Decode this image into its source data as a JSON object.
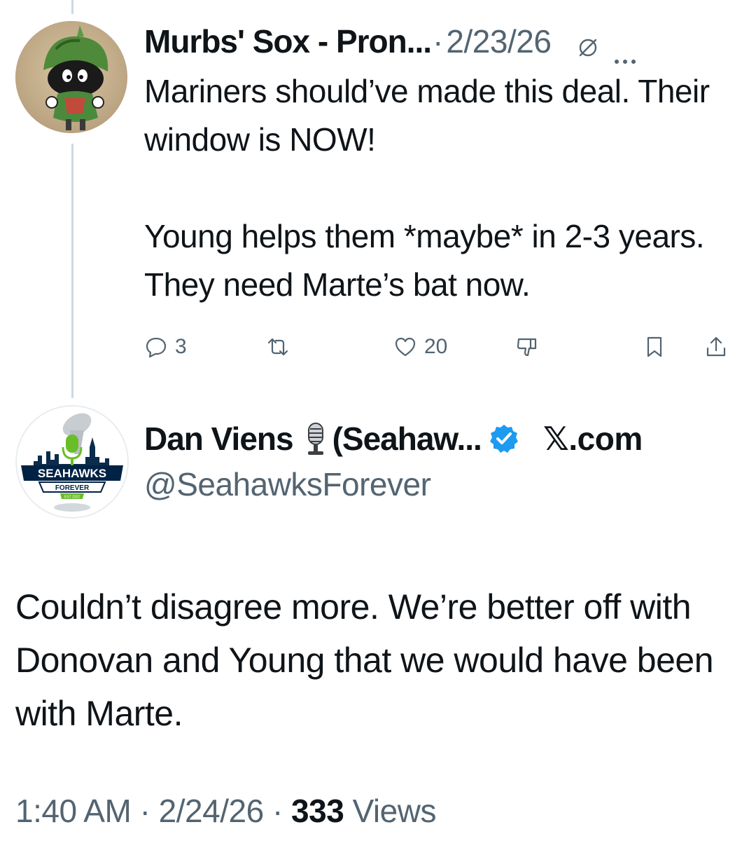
{
  "reply": {
    "name": "Murbs' Sox - Pron...",
    "separator": "·",
    "date": "2/23/26",
    "body_lines": [
      "Mariners should’ve made this deal. Their window is NOW!",
      "Young helps them *maybe* in 2-3 years. They need Marte’s bat now."
    ],
    "actions": {
      "replies": "3",
      "likes": "20"
    }
  },
  "main": {
    "name": "Dan Viens",
    "name_suffix": "(Seahaw...",
    "site": "𝕏.com",
    "handle": "@SeahawksForever",
    "body": "Couldn’t disagree more. We’re better off with Donovan and Young that we would have been with Marte.",
    "time": "1:40 AM",
    "date": "2/24/26",
    "views_count": "333",
    "views_label": "Views",
    "dot": "·"
  },
  "logo": {
    "banner": "SEAHAWKS",
    "sub": "FOREVER",
    "est": "EST 2022"
  },
  "icons": {
    "reply": "speech-bubble-icon",
    "retweet": "retweet-icon",
    "like": "heart-icon",
    "dislike": "thumbs-down-icon",
    "bookmark": "bookmark-icon",
    "share": "share-icon",
    "verified": "verified-badge-icon",
    "mic": "microphone-icon",
    "grok": "grok-icon",
    "more": "more-icon"
  },
  "colors": {
    "text": "#0f1419",
    "secondary": "#536471",
    "verified": "#1d9bf0",
    "logo_green": "#69be28",
    "logo_navy": "#002244"
  }
}
